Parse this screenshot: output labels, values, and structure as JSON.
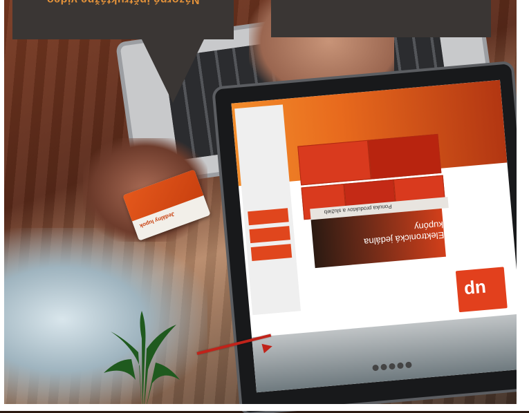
{
  "overlay": {
    "caption": "Názorné inštruktážne video"
  },
  "photo": {
    "card_brand": "Jedálny lupok",
    "screen_logo": "up",
    "screen_panel_title": "Ponuka produktov a služieb",
    "screen_banner": "Elektronická jedálna kupóny"
  },
  "colors": {
    "brand_orange": "#e2401d",
    "caption_text": "#e3923a",
    "bubble_bg": "#3a3634",
    "arrow": "#c0231a"
  }
}
